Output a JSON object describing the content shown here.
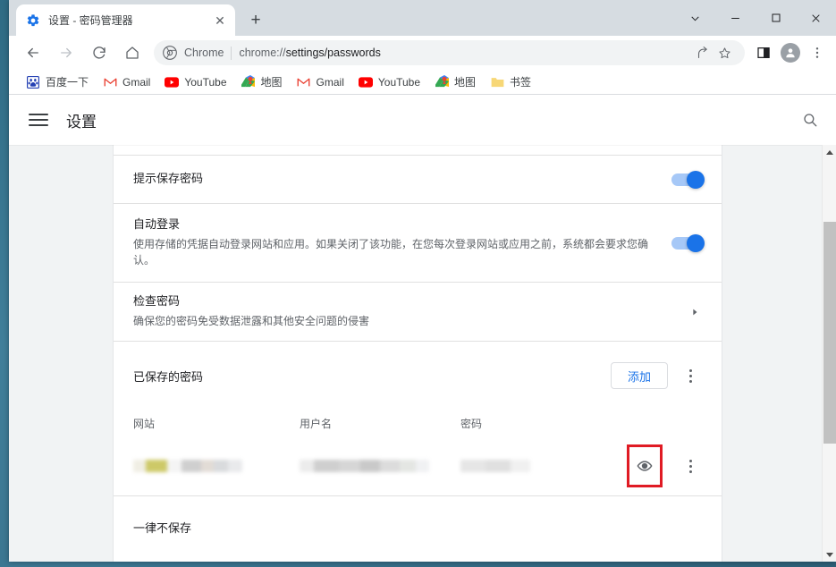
{
  "window": {
    "controls": [
      {
        "name": "tab-search",
        "glyph": "∨"
      },
      {
        "name": "minimize",
        "glyph": "—"
      },
      {
        "name": "maximize",
        "glyph": "□"
      },
      {
        "name": "close",
        "glyph": "✕"
      }
    ]
  },
  "tab": {
    "title": "设置 - 密码管理器",
    "favicon": "settings-gear-icon",
    "close_glyph": "✕",
    "new_tab_glyph": "+"
  },
  "toolbar": {
    "back_glyph": "←",
    "forward_glyph": "→",
    "reload_glyph": "↻",
    "home_glyph": "⌂",
    "omnibox": {
      "secure_label": "Chrome",
      "url_prefix": "chrome://",
      "url_bold": "settings/passwords",
      "share_icon": "share-icon",
      "bookmark_icon": "star-icon"
    },
    "side_panel_icon": "side-panel-icon",
    "profile_icon": "avatar-icon",
    "menu_icon": "three-dot-menu-icon"
  },
  "bookmarks": [
    {
      "label": "百度一下",
      "icon": "baidu-icon"
    },
    {
      "label": "Gmail",
      "icon": "gmail-icon"
    },
    {
      "label": "YouTube",
      "icon": "youtube-icon"
    },
    {
      "label": "地图",
      "icon": "maps-icon"
    },
    {
      "label": "Gmail",
      "icon": "gmail-icon"
    },
    {
      "label": "YouTube",
      "icon": "youtube-icon"
    },
    {
      "label": "地图",
      "icon": "maps-icon"
    },
    {
      "label": "书签",
      "icon": "folder-icon"
    }
  ],
  "settings_header": {
    "menu_icon": "hamburger-menu-icon",
    "title": "设置",
    "search_icon": "search-icon"
  },
  "settings": {
    "clipped_row_text": " ",
    "prompt_save": {
      "title": "提示保存密码",
      "toggle_state": "on"
    },
    "auto_signin": {
      "title": "自动登录",
      "subtitle": "使用存储的凭据自动登录网站和应用。如果关闭了该功能，在您每次登录网站或应用之前，系统都会要求您确认。",
      "toggle_state": "on"
    },
    "check_passwords": {
      "title": "检查密码",
      "subtitle": "确保您的密码免受数据泄露和其他安全问题的侵害",
      "chevron": "▸"
    },
    "saved_passwords": {
      "title": "已保存的密码",
      "add_label": "添加",
      "more_icon": "three-dot-menu-icon"
    },
    "table": {
      "columns": [
        "网站",
        "用户名",
        "密码"
      ],
      "rows": [
        {
          "site": "",
          "username": "",
          "password": "",
          "show_password_icon": "eye-icon",
          "row_menu_icon": "three-dot-menu-icon",
          "redacted": true
        }
      ]
    },
    "never_saved": {
      "title": "一律不保存"
    }
  },
  "annotation": {
    "highlight_color": "#e01b24",
    "target": "show-password-eye-button"
  },
  "scrollbar": {
    "up_glyph": "▲",
    "down_glyph": "▼"
  },
  "colors": {
    "accent_blue": "#1a73e8",
    "toggle_track": "#a6c8f7",
    "annotation_red": "#e01b24",
    "desktop": "#3d7a93"
  }
}
